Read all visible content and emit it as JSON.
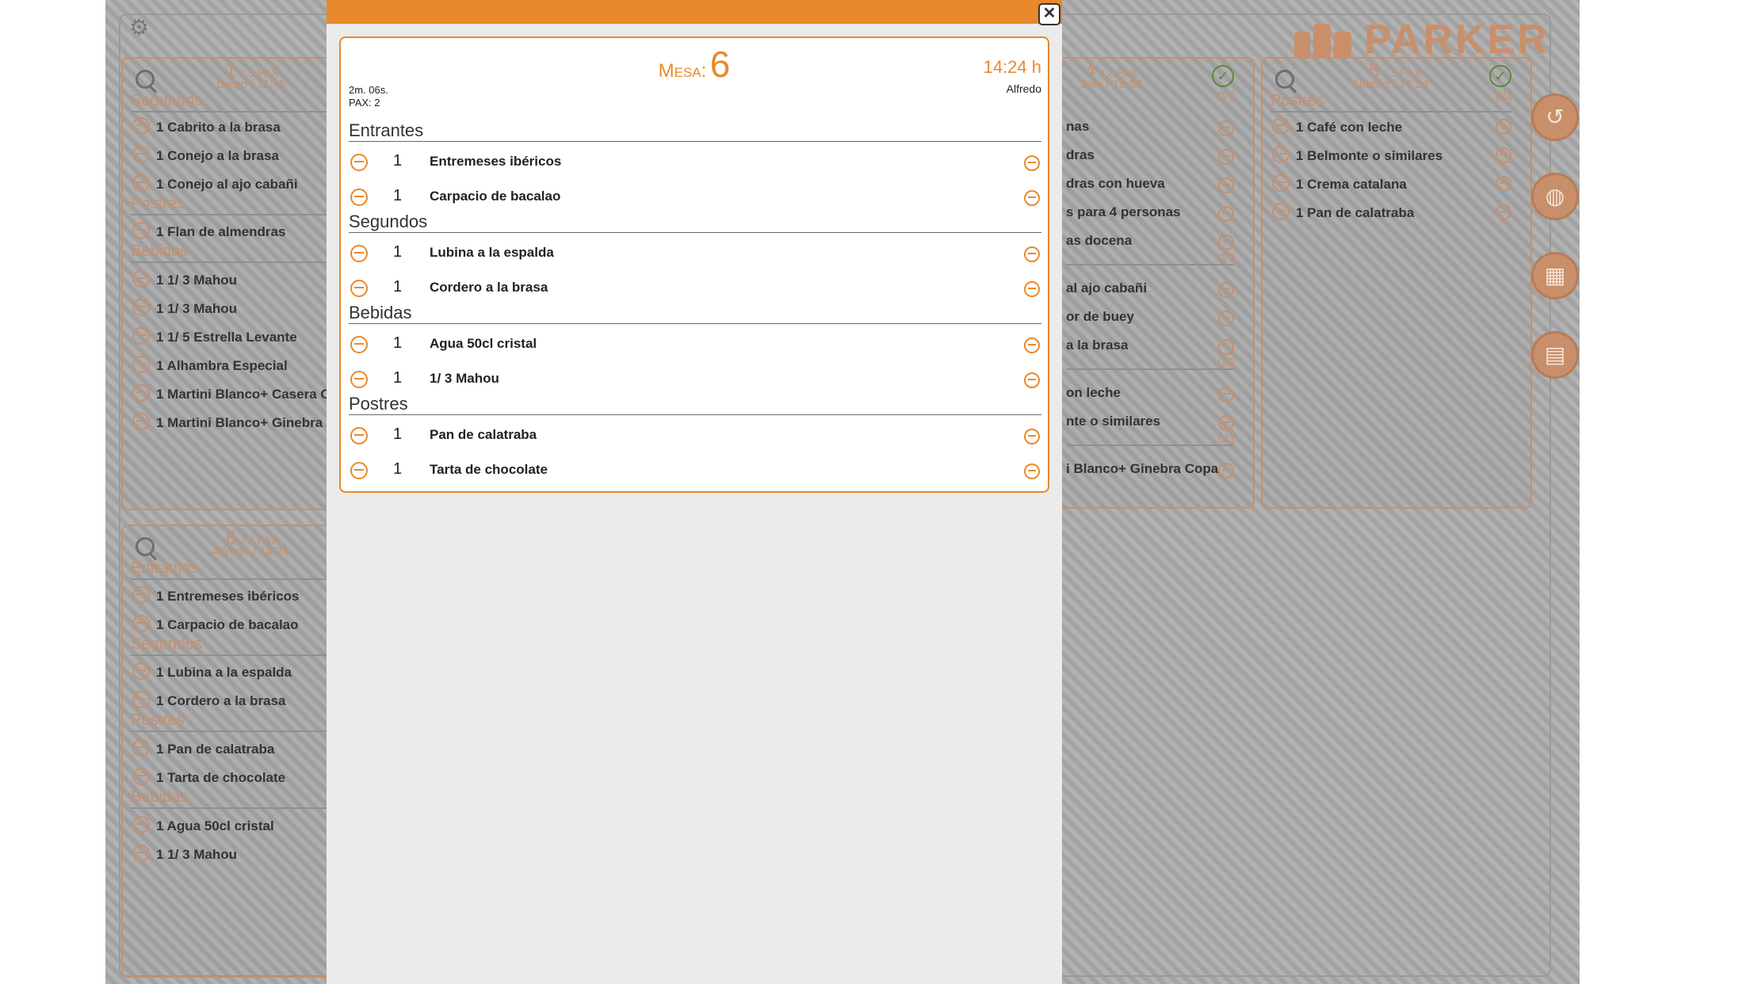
{
  "brand": {
    "name": "PARKER"
  },
  "cards": {
    "t1": {
      "num": "1",
      "pax": "/ 3 PAX",
      "who": "Diego / 11:45",
      "sections": [
        {
          "label": "Segundos",
          "items": [
            "1 Cabrito a la brasa",
            "1 Conejo a la brasa",
            "1 Conejo al ajo cabañi"
          ]
        },
        {
          "label": "Postres",
          "items": [
            "1 Flan de almendras"
          ]
        },
        {
          "label": "Bebidas",
          "items": [
            "1 1/ 3 Mahou",
            "1 1/ 3 Mahou",
            "1 1/ 5 Estrella Levante",
            "1 Alhambra Especial",
            "1 Martini Blanco+ Casera Co",
            "1 Martini Blanco+ Ginebra C"
          ]
        }
      ]
    },
    "t4": {
      "num": "4",
      "pax": "/ 2 PAX",
      "who": "Jefe / 19:53",
      "count": "0/5",
      "items": [
        "nas",
        "dras",
        "dras con hueva",
        "s para 4 personas",
        "as docena"
      ],
      "count2": "0/3",
      "items2": [
        "al ajo cabañi",
        "or de buey",
        "a la brasa"
      ],
      "count3": "0/2",
      "items3": [
        "on leche",
        "nte o similares"
      ],
      "count4": "0/1",
      "items4": [
        "i Blanco+ Ginebra Copa"
      ]
    },
    "t5": {
      "num": "5",
      "pax": "/ 3 PAX",
      "who": "Alfredo / 14:24",
      "count": "0/4",
      "sections": [
        {
          "label": "Postres",
          "items": [
            "1 Café con leche",
            "1 Belmonte o similares",
            "1 Crema catalana",
            "1 Pan de calatraba"
          ]
        }
      ]
    },
    "t6": {
      "num": "6",
      "pax": "/ 2 PAX",
      "who": "Alfredo / 14:24",
      "sections": [
        {
          "label": "Entrantes",
          "items": [
            "1 Entremeses ibéricos",
            "1 Carpacio de bacalao"
          ]
        },
        {
          "label": "Segundos",
          "items": [
            "1 Lubina a la espalda",
            "1 Cordero a la brasa"
          ]
        },
        {
          "label": "Postres",
          "items": [
            "1 Pan de calatraba",
            "1 Tarta de chocolate"
          ]
        },
        {
          "label": "Bebidas",
          "items": [
            "1 Agua 50cl cristal",
            "1 1/ 3 Mahou"
          ]
        }
      ]
    }
  },
  "ticket": {
    "mesa_label": "Mesa:",
    "mesa_value": "6",
    "time": "14:24 h",
    "waiter": "Alfredo",
    "elapsed": "2m. 06s.",
    "pax": "PAX: 2",
    "sections": [
      {
        "label": "Entrantes",
        "items": [
          {
            "qty": "1",
            "name": "Entremeses ibéricos"
          },
          {
            "qty": "1",
            "name": "Carpacio de bacalao"
          }
        ]
      },
      {
        "label": "Segundos",
        "items": [
          {
            "qty": "1",
            "name": "Lubina a la espalda"
          },
          {
            "qty": "1",
            "name": "Cordero a la brasa"
          }
        ]
      },
      {
        "label": "Bebidas",
        "items": [
          {
            "qty": "1",
            "name": "Agua 50cl cristal"
          },
          {
            "qty": "1",
            "name": "1/ 3 Mahou"
          }
        ]
      },
      {
        "label": "Postres",
        "items": [
          {
            "qty": "1",
            "name": "Pan de calatraba"
          },
          {
            "qty": "1",
            "name": "Tarta de chocolate"
          }
        ]
      }
    ]
  },
  "fabs": [
    "history-icon",
    "dish-icon",
    "calendar-icon",
    "store-icon"
  ],
  "colors": {
    "accent": "#e8892b",
    "muted_accent": "#c98f6a",
    "background": "#a9a9a9"
  }
}
